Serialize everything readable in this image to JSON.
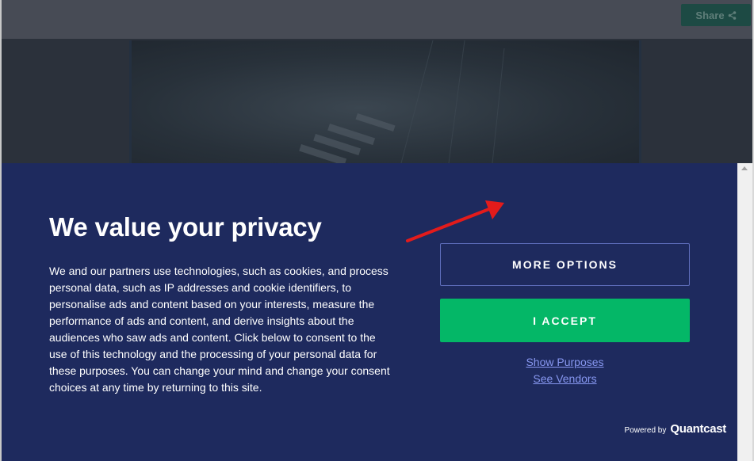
{
  "header": {
    "share_label": "Share",
    "share_icon": "share-icon"
  },
  "consent": {
    "title": "We value your privacy",
    "body": "We and our partners use technologies, such as cookies, and process personal data, such as IP addresses and cookie identifiers, to personalise ads and content based on your interests, measure the performance of ads and content, and derive insights about the audiences who saw ads and content. Click below to consent to the use of this technology and the processing of your personal data for these purposes. You can change your mind and change your consent choices at any time by returning to this site.",
    "more_options_label": "MORE OPTIONS",
    "accept_label": "I ACCEPT",
    "show_purposes_label": "Show Purposes",
    "see_vendors_label": "See Vendors",
    "powered_by_label": "Powered by",
    "brand_label": "Quantcast"
  },
  "colors": {
    "dialog_background": "#1e2a5e",
    "accept_green": "#04b767",
    "link_blue": "#8797f0",
    "annotation_red": "#e31b1b"
  }
}
